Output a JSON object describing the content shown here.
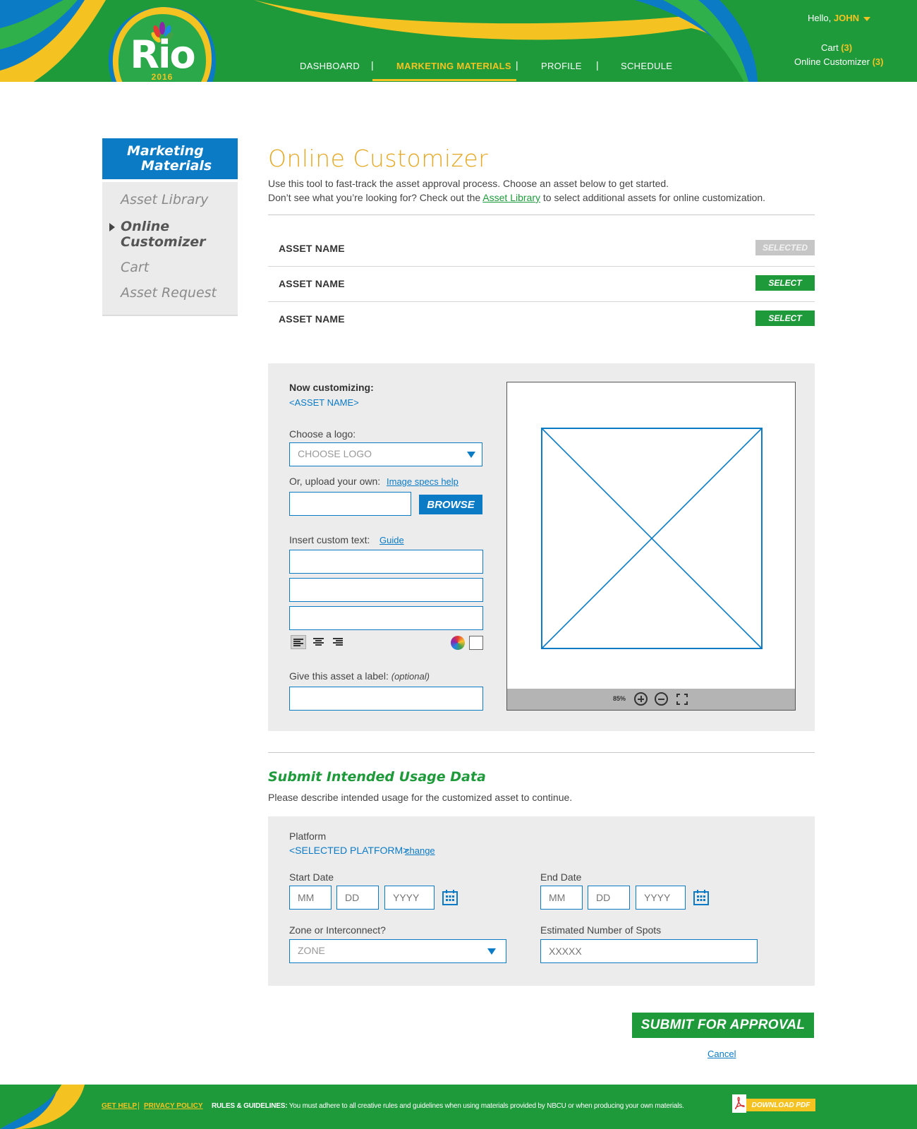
{
  "header": {
    "logo_text": "Rio",
    "logo_year": "2016",
    "nav": [
      {
        "label": "DASHBOARD"
      },
      {
        "label": "MARKETING MATERIALS"
      },
      {
        "label": "PROFILE"
      },
      {
        "label": "SCHEDULE"
      }
    ],
    "nav_separator": "|",
    "hello_label": "Hello,",
    "user_name": "JOHN",
    "cart_label": "Cart",
    "cart_count": "(3)",
    "online_customizer_label": "Online Customizer",
    "online_customizer_count": "(3)"
  },
  "sidebar": {
    "title_line1": "Marketing",
    "title_line2": "Materials",
    "items": [
      {
        "label": "Asset Library"
      },
      {
        "label": "Online Customizer"
      },
      {
        "label": "Cart"
      },
      {
        "label": "Asset Request"
      }
    ]
  },
  "main": {
    "title": "Online Customizer",
    "intro_line1": "Use this tool to fast-track the asset approval process. Choose an asset below to get started.",
    "intro_line2_before": "Don’t see what you’re looking for? Check out the ",
    "intro_link": "Asset Library",
    "intro_line2_after": " to select additional assets for online customization.",
    "assets": [
      {
        "name": "ASSET NAME",
        "button": "SELECTED",
        "selected": true
      },
      {
        "name": "ASSET NAME",
        "button": "SELECT",
        "selected": false
      },
      {
        "name": "ASSET NAME",
        "button": "SELECT",
        "selected": false
      }
    ]
  },
  "customizer": {
    "now_customizing": "Now customizing:",
    "asset_name": "<ASSET NAME>",
    "choose_logo_label": "Choose a logo:",
    "choose_logo_value": "CHOOSE LOGO",
    "upload_label": "Or, upload your own:",
    "image_specs_link": "Image specs help",
    "browse_button": "BROWSE",
    "custom_text_label": "Insert custom text:",
    "guide_link": "Guide",
    "asset_label_label": "Give this asset a label:",
    "optional": "(optional)",
    "zoom": "85%"
  },
  "usage": {
    "title": "Submit Intended Usage Data",
    "description": "Please describe intended usage for the customized asset to continue.",
    "platform_label": "Platform",
    "platform_value": "<SELECTED PLATFORM>",
    "change_link": "change",
    "start_date_label": "Start Date",
    "end_date_label": "End Date",
    "mm": "MM",
    "dd": "DD",
    "yyyy": "YYYY",
    "zone_label": "Zone or Interconnect?",
    "zone_value": "ZONE",
    "spots_label": "Estimated Number of Spots",
    "spots_placeholder": "XXXXX"
  },
  "actions": {
    "submit": "SUBMIT FOR APPROVAL",
    "cancel": "Cancel"
  },
  "footer": {
    "get_help": "GET HELP",
    "separator": "|",
    "privacy_policy": "PRIVACY POLICY",
    "rules_title": "RULES & GUIDELINES:",
    "rules_text": "You must adhere to all creative rules and guidelines when using materials provided by NBCU or when producing your own materials.",
    "download_pdf": "DOWNLOAD PDF"
  },
  "colors": {
    "brand_green": "#1e9a3b",
    "brand_yellow": "#f4c322",
    "brand_blue": "#0b7bc6",
    "title_gold": "#e5a823"
  }
}
